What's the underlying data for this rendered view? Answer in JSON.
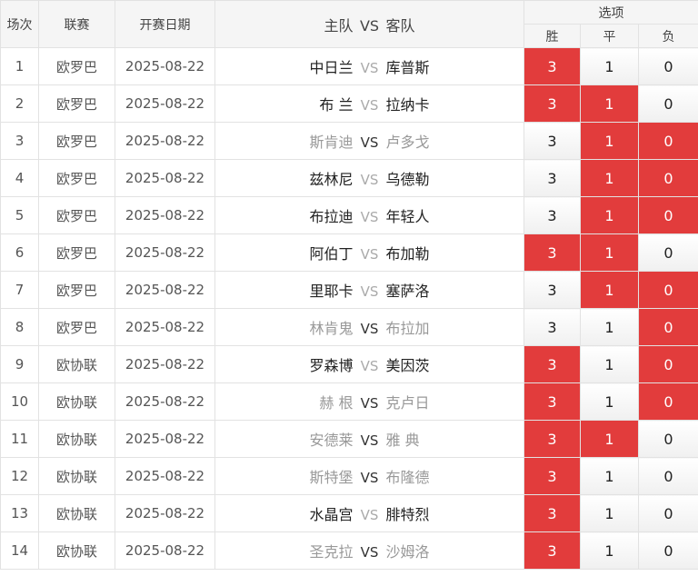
{
  "header": {
    "col_index": "场次",
    "col_league": "联赛",
    "col_date": "开赛日期",
    "col_home": "主队",
    "col_vs": "VS",
    "col_away": "客队",
    "col_options": "选项",
    "opt_win": "胜",
    "opt_draw": "平",
    "opt_lose": "负"
  },
  "option_values": {
    "win": "3",
    "draw": "1",
    "lose": "0"
  },
  "colors": {
    "selected": "#e23c3c"
  },
  "rows": [
    {
      "idx": "1",
      "league": "欧罗巴",
      "date": "2025-08-22",
      "home": "中日兰",
      "away": "库普斯",
      "dim": false,
      "sel": [
        true,
        false,
        false
      ]
    },
    {
      "idx": "2",
      "league": "欧罗巴",
      "date": "2025-08-22",
      "home": "布 兰",
      "away": "拉纳卡",
      "dim": false,
      "sel": [
        true,
        true,
        false
      ]
    },
    {
      "idx": "3",
      "league": "欧罗巴",
      "date": "2025-08-22",
      "home": "斯肯迪",
      "away": "卢多戈",
      "dim": true,
      "sel": [
        false,
        true,
        true
      ]
    },
    {
      "idx": "4",
      "league": "欧罗巴",
      "date": "2025-08-22",
      "home": "兹林尼",
      "away": "乌德勒",
      "dim": false,
      "sel": [
        false,
        true,
        true
      ]
    },
    {
      "idx": "5",
      "league": "欧罗巴",
      "date": "2025-08-22",
      "home": "布拉迪",
      "away": "年轻人",
      "dim": false,
      "sel": [
        false,
        true,
        true
      ]
    },
    {
      "idx": "6",
      "league": "欧罗巴",
      "date": "2025-08-22",
      "home": "阿伯丁",
      "away": "布加勒",
      "dim": false,
      "sel": [
        true,
        true,
        false
      ]
    },
    {
      "idx": "7",
      "league": "欧罗巴",
      "date": "2025-08-22",
      "home": "里耶卡",
      "away": "塞萨洛",
      "dim": false,
      "sel": [
        false,
        true,
        true
      ]
    },
    {
      "idx": "8",
      "league": "欧罗巴",
      "date": "2025-08-22",
      "home": "林肯鬼",
      "away": "布拉加",
      "dim": true,
      "sel": [
        false,
        false,
        true
      ]
    },
    {
      "idx": "9",
      "league": "欧协联",
      "date": "2025-08-22",
      "home": "罗森博",
      "away": "美因茨",
      "dim": false,
      "sel": [
        true,
        false,
        true
      ]
    },
    {
      "idx": "10",
      "league": "欧协联",
      "date": "2025-08-22",
      "home": "赫 根",
      "away": "克卢日",
      "dim": true,
      "sel": [
        true,
        false,
        true
      ]
    },
    {
      "idx": "11",
      "league": "欧协联",
      "date": "2025-08-22",
      "home": "安德莱",
      "away": "雅 典",
      "dim": true,
      "sel": [
        true,
        true,
        false
      ]
    },
    {
      "idx": "12",
      "league": "欧协联",
      "date": "2025-08-22",
      "home": "斯特堡",
      "away": "布隆德",
      "dim": true,
      "sel": [
        true,
        false,
        false
      ]
    },
    {
      "idx": "13",
      "league": "欧协联",
      "date": "2025-08-22",
      "home": "水晶宫",
      "away": "腓特烈",
      "dim": false,
      "sel": [
        true,
        false,
        false
      ]
    },
    {
      "idx": "14",
      "league": "欧协联",
      "date": "2025-08-22",
      "home": "圣克拉",
      "away": "沙姆洛",
      "dim": true,
      "sel": [
        true,
        false,
        false
      ]
    }
  ]
}
